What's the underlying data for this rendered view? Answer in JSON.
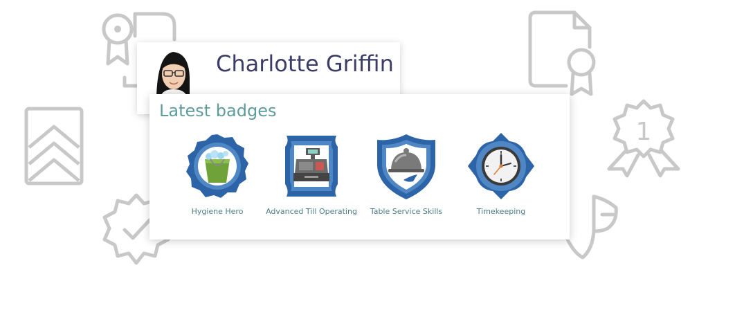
{
  "profile": {
    "name": "Charlotte Griffin"
  },
  "badges_section": {
    "title": "Latest badges",
    "badges": [
      {
        "label": "Hygiene Hero",
        "icon": "bucket-icon"
      },
      {
        "label": "Advanced Till Operating",
        "icon": "cash-register-icon"
      },
      {
        "label": "Table Service Skills",
        "icon": "cloche-icon"
      },
      {
        "label": "Timekeeping",
        "icon": "clock-icon"
      }
    ]
  },
  "background_decorations": {
    "first_place_rosette_numeral": "1"
  },
  "colors": {
    "badge_blue": "#2d64a8",
    "badge_blue_light": "#4f87c4",
    "decoration_gray": "#c8c8c8",
    "title_teal": "#5e9c9c",
    "name_navy": "#3b3d66"
  }
}
